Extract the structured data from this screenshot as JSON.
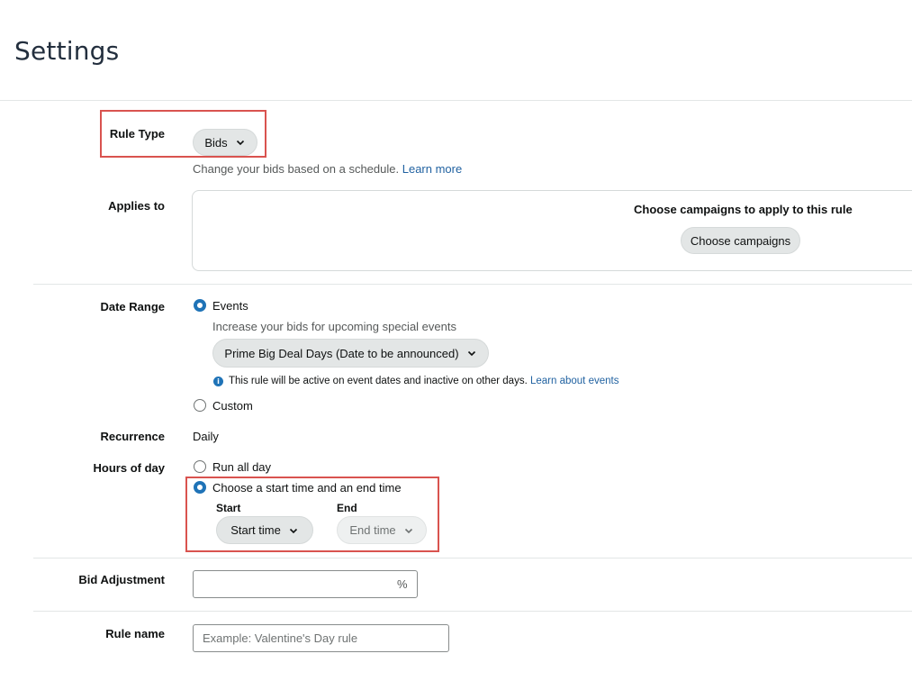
{
  "page": {
    "title": "Settings"
  },
  "rule_type": {
    "label": "Rule Type",
    "value": "Bids",
    "helper": "Change your bids based on a schedule.",
    "learn_more": "Learn more"
  },
  "applies_to": {
    "label": "Applies to",
    "heading": "Choose campaigns to apply to this rule",
    "button": "Choose campaigns"
  },
  "date_range": {
    "label": "Date Range",
    "events_label": "Events",
    "events_selected": true,
    "events_helper": "Increase your bids for upcoming special events",
    "event_value": "Prime Big Deal Days (Date to be announced)",
    "info_text": "This rule will be active on event dates and inactive on other days.",
    "info_link": "Learn about events",
    "custom_label": "Custom"
  },
  "recurrence": {
    "label": "Recurrence",
    "value": "Daily"
  },
  "hours_of_day": {
    "label": "Hours of day",
    "run_all_day": "Run all day",
    "choose_time": "Choose a start time and an end time",
    "start_label": "Start",
    "start_value": "Start time",
    "end_label": "End",
    "end_value": "End time"
  },
  "bid_adjustment": {
    "label": "Bid Adjustment",
    "value": "",
    "suffix": "%"
  },
  "rule_name": {
    "label": "Rule name",
    "placeholder": "Example: Valentine's Day rule"
  },
  "colors": {
    "accent": "#1f73b7",
    "link": "#2162a1",
    "highlight": "#d9534f"
  },
  "icons": {
    "chevron": "chevron-down-icon",
    "info": "info-icon"
  }
}
